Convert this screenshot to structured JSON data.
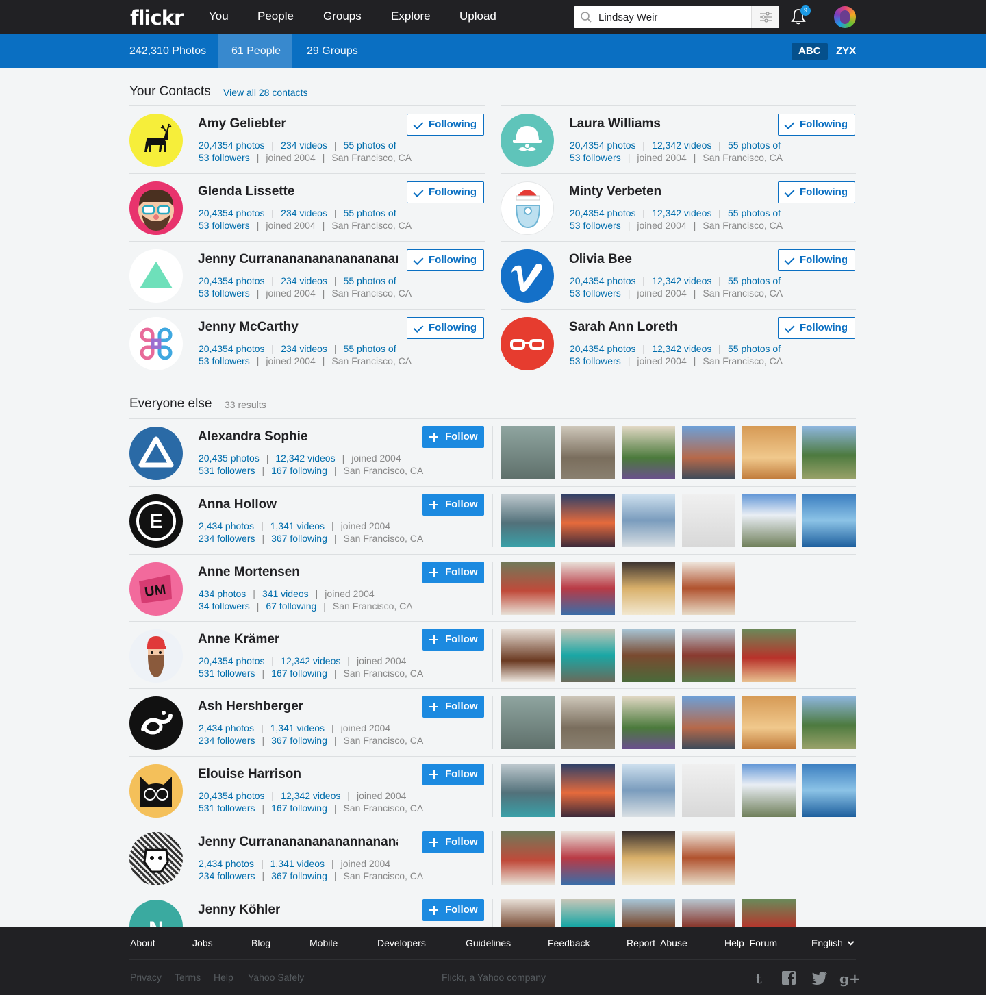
{
  "topnav": {
    "logo": "flickr",
    "links": [
      "You",
      "People",
      "Groups",
      "Explore",
      "Upload"
    ],
    "search_value": "Lindsay Weir",
    "notification_count": "9"
  },
  "subnav": {
    "tabs": [
      "242,310 Photos",
      "61 People",
      "29 Groups"
    ],
    "active_tab": "61 People",
    "sort": [
      "ABC",
      "ZYX"
    ]
  },
  "contacts": {
    "title": "Your Contacts",
    "view_all": "View all 28 contacts",
    "following_label": "Following",
    "items": [
      {
        "name": "Amy Geliebter",
        "s1": "20,4354 photos",
        "s2": "234 videos",
        "s3": "55 photos of",
        "s4": "53 followers",
        "s5": "joined 2004",
        "s6": "San Francisco, CA"
      },
      {
        "name": "Laura Williams",
        "s1": "20,4354 photos",
        "s2": "12,342 videos",
        "s3": "55 photos of",
        "s4": "53 followers",
        "s5": "joined 2004",
        "s6": "San Francisco, CA"
      },
      {
        "name": "Glenda Lissette",
        "s1": "20,4354 photos",
        "s2": "234 videos",
        "s3": "55 photos of",
        "s4": "53 followers",
        "s5": "joined 2004",
        "s6": "San Francisco, CA"
      },
      {
        "name": "Minty Verbeten",
        "s1": "20,4354 photos",
        "s2": "12,342 videos",
        "s3": "55 photos of",
        "s4": "53 followers",
        "s5": "joined 2004",
        "s6": "San Francisco, CA"
      },
      {
        "name": "Jenny Currananananananananan...",
        "s1": "20,4354 photos",
        "s2": "234 videos",
        "s3": "55 photos of",
        "s4": "53 followers",
        "s5": "joined 2004",
        "s6": "San Francisco, CA"
      },
      {
        "name": "Olivia Bee",
        "s1": "20,4354 photos",
        "s2": "12,342 videos",
        "s3": "55 photos of",
        "s4": "53 followers",
        "s5": "joined 2004",
        "s6": "San Francisco, CA"
      },
      {
        "name": "Jenny McCarthy",
        "s1": "20,4354 photos",
        "s2": "234 videos",
        "s3": "55 photos of",
        "s4": "53 followers",
        "s5": "joined 2004",
        "s6": "San Francisco, CA"
      },
      {
        "name": "Sarah Ann Loreth",
        "s1": "20,4354 photos",
        "s2": "12,342 videos",
        "s3": "55 photos of",
        "s4": "53 followers",
        "s5": "joined 2004",
        "s6": "San Francisco, CA"
      }
    ]
  },
  "everyone": {
    "title": "Everyone else",
    "count": "33 results",
    "follow_label": "Follow",
    "items": [
      {
        "name": "Alexandra Sophie",
        "s1": "20,435 photos",
        "s2": "12,342 videos",
        "s3": "joined 2004",
        "s4": "531 followers",
        "s5": "167 following",
        "s6": "San Francisco, CA"
      },
      {
        "name": "Anna Hollow",
        "s1": "2,434 photos",
        "s2": "1,341 videos",
        "s3": "joined 2004",
        "s4": "234 followers",
        "s5": "367 following",
        "s6": "San Francisco, CA"
      },
      {
        "name": "Anne Mortensen",
        "s1": "434 photos",
        "s2": "341 videos",
        "s3": "joined 2004",
        "s4": "34 followers",
        "s5": "67 following",
        "s6": "San Francisco, CA"
      },
      {
        "name": "Anne Krämer",
        "s1": "20,4354 photos",
        "s2": "12,342 videos",
        "s3": "joined 2004",
        "s4": "531 followers",
        "s5": "167 following",
        "s6": "San Francisco, CA"
      },
      {
        "name": "Ash Hershberger",
        "s1": "2,434 photos",
        "s2": "1,341 videos",
        "s3": "joined 2004",
        "s4": "234 followers",
        "s5": "367 following",
        "s6": "San Francisco, CA"
      },
      {
        "name": "Elouise Harrison",
        "s1": "20,4354 photos",
        "s2": "12,342 videos",
        "s3": "joined 2004",
        "s4": "531 followers",
        "s5": "167 following",
        "s6": "San Francisco, CA"
      },
      {
        "name": "Jenny Curranananananannanana...",
        "s1": "2,434 photos",
        "s2": "1,341 videos",
        "s3": "joined 2004",
        "s4": "234 followers",
        "s5": "367 following",
        "s6": "San Francisco, CA"
      },
      {
        "name": "Jenny Köhler",
        "s1": "",
        "s2": "",
        "s3": "",
        "s4": "",
        "s5": "",
        "s6": ""
      }
    ]
  },
  "footer": {
    "links": [
      "About",
      "Jobs",
      "Blog",
      "Mobile",
      "Developers",
      "Guidelines",
      "Feedback",
      "Report  Abuse",
      "Help  Forum"
    ],
    "language": "English",
    "small_links": [
      "Privacy",
      "Terms",
      "Help",
      "Yahoo Safely"
    ],
    "company": "Flickr, a Yahoo company",
    "social_icons": [
      "tumblr-icon",
      "facebook-icon",
      "twitter-icon",
      "google-plus-icon"
    ]
  }
}
